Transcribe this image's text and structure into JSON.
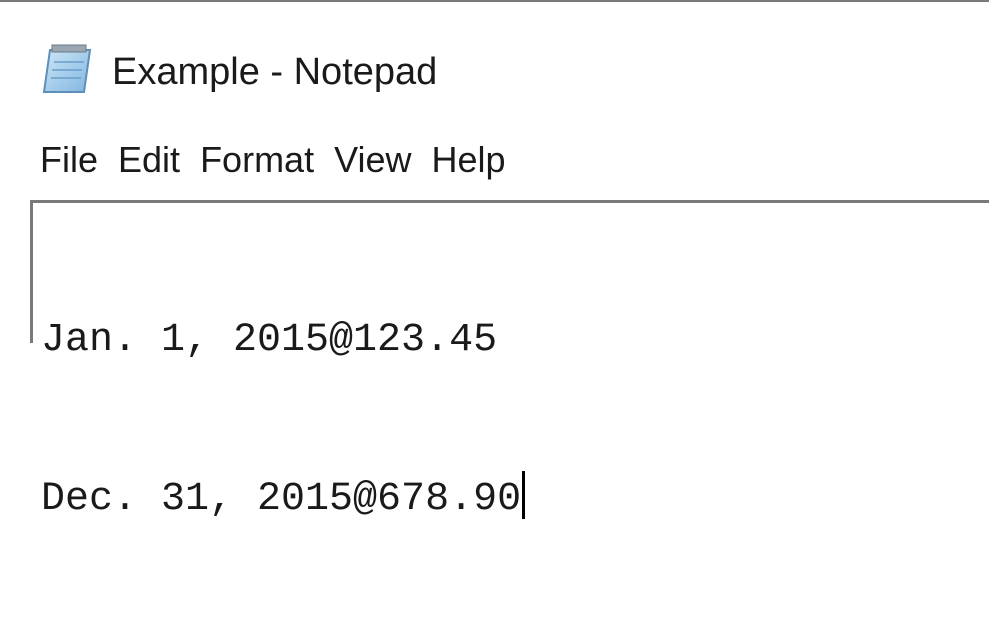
{
  "window": {
    "title": "Example - Notepad",
    "icon": "notepad-icon"
  },
  "menu": {
    "items": [
      {
        "label": "File"
      },
      {
        "label": "Edit"
      },
      {
        "label": "Format"
      },
      {
        "label": "View"
      },
      {
        "label": "Help"
      }
    ]
  },
  "editor": {
    "lines": [
      "Jan. 1, 2015@123.45",
      "Dec. 31, 2015@678.90"
    ]
  },
  "colors": {
    "text": "#1a1a1a",
    "border": "#7a7a7a",
    "background": "#ffffff"
  }
}
